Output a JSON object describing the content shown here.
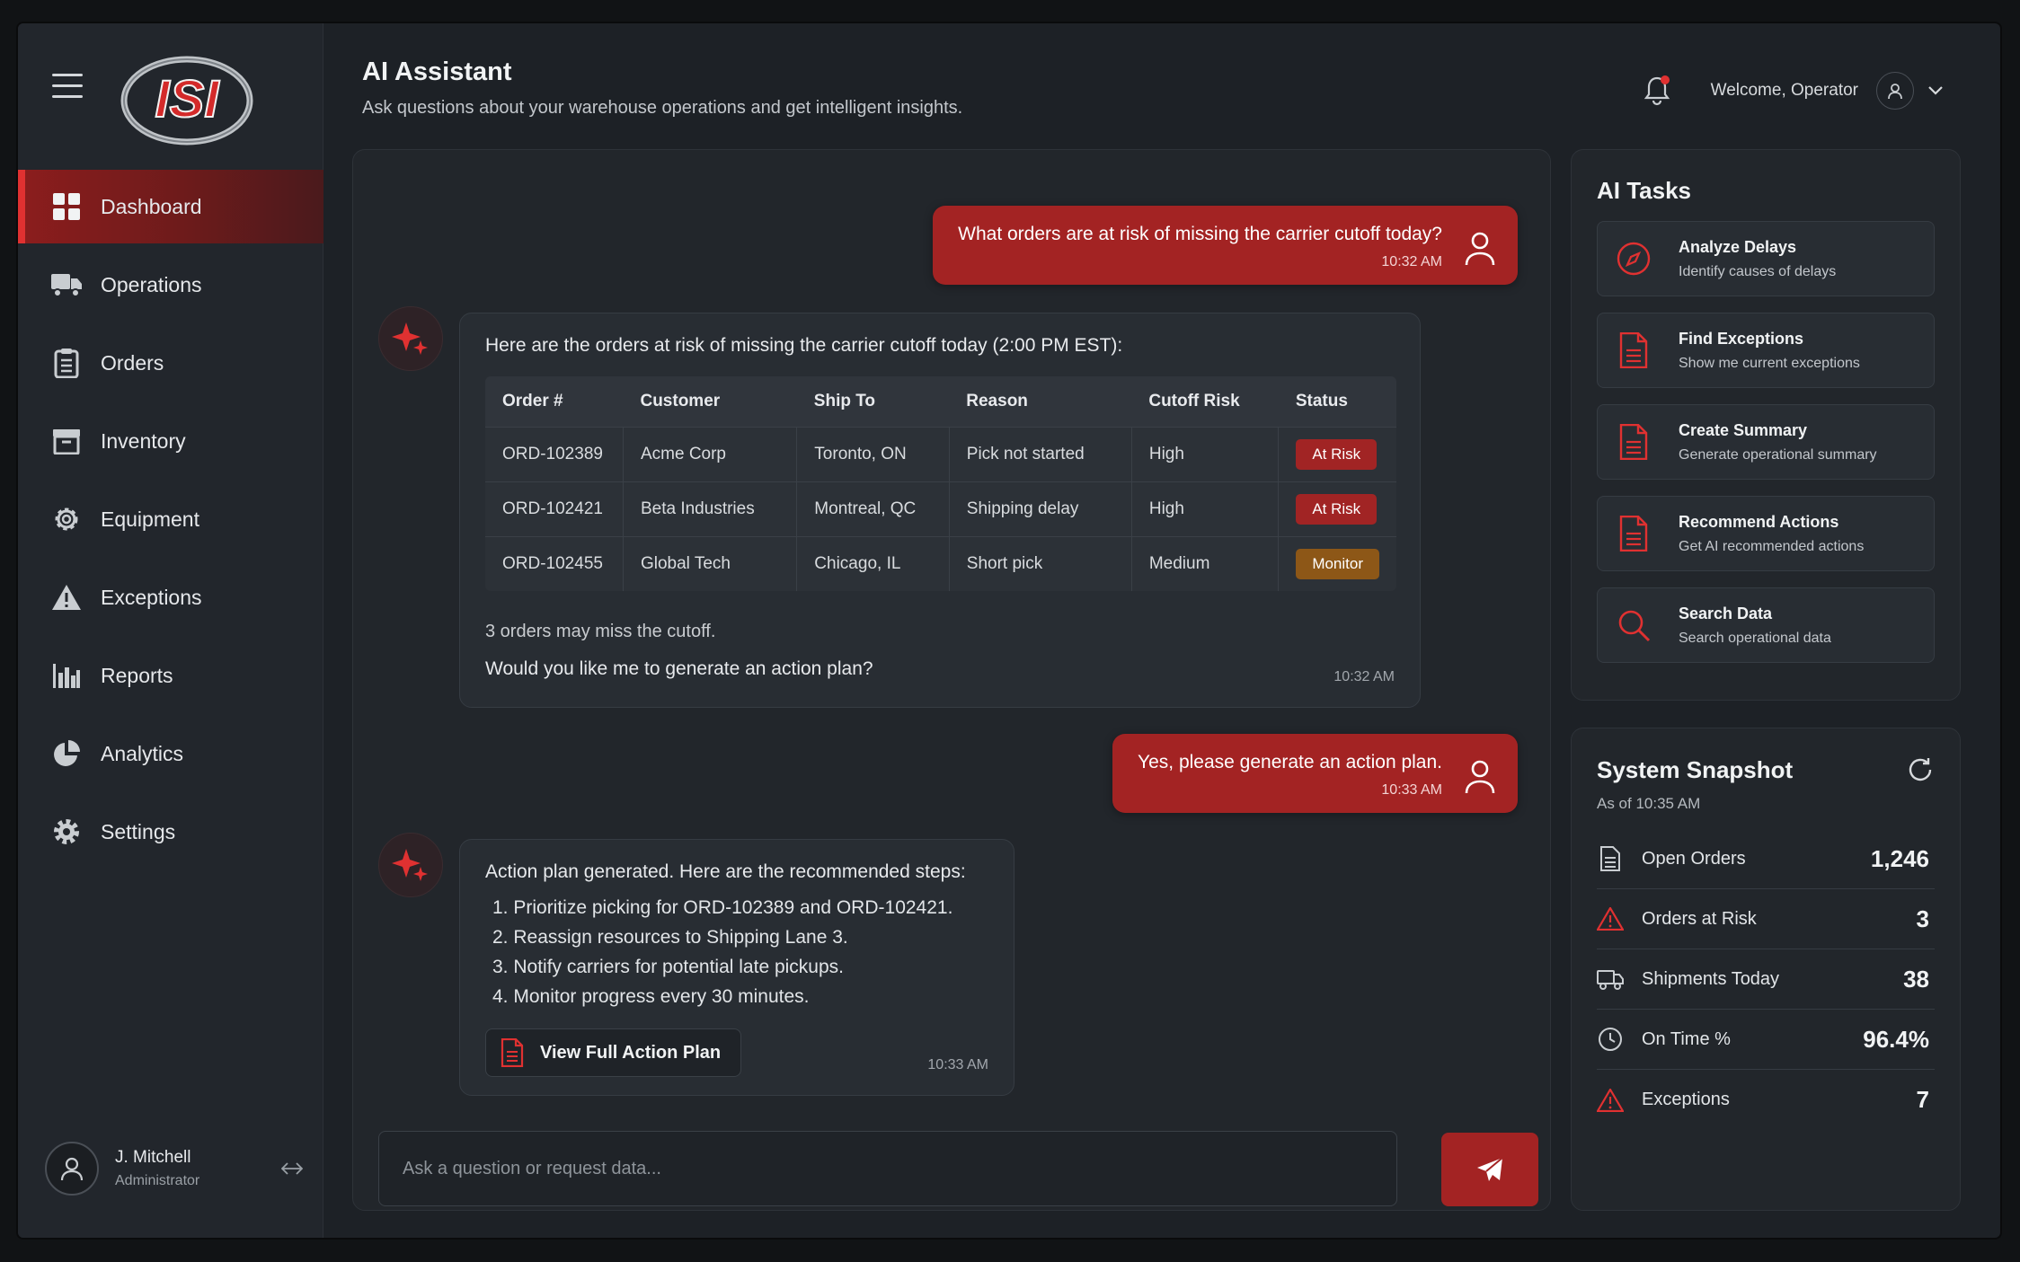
{
  "brand": {
    "logo_text": "ISI",
    "accent": "#a32323",
    "accent_bright": "#e03131"
  },
  "sidebar": {
    "items": [
      {
        "label": "Dashboard",
        "icon": "dashboard-grid-icon",
        "active": true
      },
      {
        "label": "Operations",
        "icon": "truck-icon"
      },
      {
        "label": "Orders",
        "icon": "clipboard-icon"
      },
      {
        "label": "Inventory",
        "icon": "box-icon"
      },
      {
        "label": "Equipment",
        "icon": "gear-icon"
      },
      {
        "label": "Exceptions",
        "icon": "warning-icon"
      },
      {
        "label": "Reports",
        "icon": "bar-chart-icon"
      },
      {
        "label": "Analytics",
        "icon": "pie-chart-icon"
      },
      {
        "label": "Settings",
        "icon": "settings-icon"
      }
    ],
    "user": {
      "name": "J. Mitchell",
      "role": "Administrator"
    }
  },
  "header": {
    "title": "AI Assistant",
    "subtitle": "Ask questions about your warehouse operations and get intelligent insights.",
    "welcome": "Welcome, Operator"
  },
  "chat": {
    "msg1": {
      "text": "What orders are at risk of missing the carrier cutoff today?",
      "time": "10:32 AM"
    },
    "reply1": {
      "lead": "Here are the orders at risk of missing the carrier cutoff today (2:00 PM EST):",
      "columns": [
        "Order #",
        "Customer",
        "Ship To",
        "Reason",
        "Cutoff Risk",
        "Status"
      ],
      "rows": [
        {
          "order": "ORD-102389",
          "customer": "Acme Corp",
          "ship_to": "Toronto, ON",
          "reason": "Pick not started",
          "risk": "High",
          "status": "At Risk"
        },
        {
          "order": "ORD-102421",
          "customer": "Beta Industries",
          "ship_to": "Montreal, QC",
          "reason": "Shipping delay",
          "risk": "High",
          "status": "At Risk"
        },
        {
          "order": "ORD-102455",
          "customer": "Global Tech",
          "ship_to": "Chicago, IL",
          "reason": "Short pick",
          "risk": "Medium",
          "status": "Monitor"
        }
      ],
      "note": "3 orders may miss the cutoff.",
      "question": "Would you like me to generate an action plan?",
      "time": "10:32 AM"
    },
    "msg2": {
      "text": "Yes, please generate an action plan.",
      "time": "10:33 AM"
    },
    "reply2": {
      "lead": "Action plan generated. Here are the recommended steps:",
      "steps": [
        "1. Prioritize picking for ORD-102389 and ORD-102421.",
        "2. Reassign resources to Shipping Lane 3.",
        "3. Notify carriers for potential late pickups.",
        "4. Monitor progress every 30 minutes."
      ],
      "button": "View Full Action Plan",
      "time": "10:33 AM"
    },
    "input_placeholder": "Ask a question or request data..."
  },
  "tasks": {
    "title": "AI Tasks",
    "items": [
      {
        "title": "Analyze Delays",
        "sub": "Identify causes of delays",
        "icon": "compass-icon"
      },
      {
        "title": "Find Exceptions",
        "sub": "Show me current exceptions",
        "icon": "document-icon"
      },
      {
        "title": "Create Summary",
        "sub": "Generate operational summary",
        "icon": "document-icon"
      },
      {
        "title": "Recommend Actions",
        "sub": "Get AI recommended actions",
        "icon": "document-icon"
      },
      {
        "title": "Search Data",
        "sub": "Search operational data",
        "icon": "search-icon"
      }
    ]
  },
  "snapshot": {
    "title": "System Snapshot",
    "as_of": "As of 10:35 AM",
    "stats": [
      {
        "label": "Open Orders",
        "value": "1,246",
        "icon": "document-icon"
      },
      {
        "label": "Orders at Risk",
        "value": "3",
        "icon": "warning-icon"
      },
      {
        "label": "Shipments Today",
        "value": "38",
        "icon": "truck-icon"
      },
      {
        "label": "On Time %",
        "value": "96.4%",
        "icon": "clock-icon"
      },
      {
        "label": "Exceptions",
        "value": "7",
        "icon": "warning-icon"
      }
    ]
  }
}
